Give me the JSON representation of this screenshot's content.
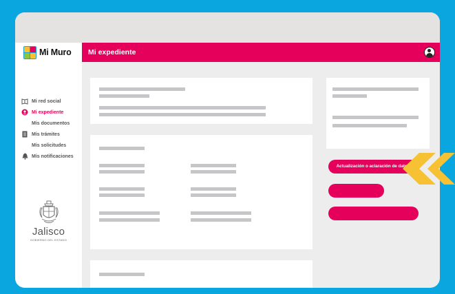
{
  "app": {
    "name": "Mi Muro"
  },
  "header": {
    "title": "Mi expediente"
  },
  "icons": {
    "avatar": "user-avatar-icon",
    "logo": "mi-muro-logo-icon"
  },
  "colors": {
    "background": "#0aa6e0",
    "brand": "#e5005b",
    "accent_arrow": "#f6c233"
  },
  "sidebar": {
    "items": [
      {
        "label": "Mi red social",
        "icon": "book-icon",
        "active": false
      },
      {
        "label": "Mi expediente",
        "icon": "user-circle-icon",
        "active": true
      },
      {
        "label": "Mis documentos",
        "icon": "",
        "active": false
      },
      {
        "label": "Mis trámites",
        "icon": "document-icon",
        "active": false
      },
      {
        "label": "Mis solicitudes",
        "icon": "",
        "active": false
      },
      {
        "label": "Mis notificaciones",
        "icon": "bell-icon",
        "active": false
      }
    ]
  },
  "footer_logo": {
    "word": "Jalisco",
    "sub": "GOBIERNO DEL ESTADO"
  },
  "actions": {
    "update_button": "Actualización o aclaración de datos"
  }
}
